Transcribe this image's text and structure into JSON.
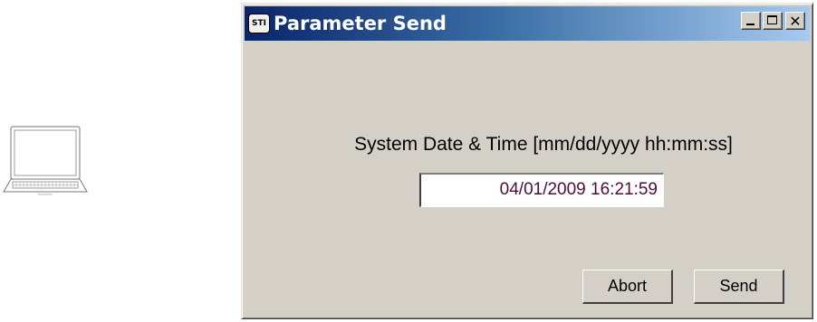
{
  "window": {
    "title": "Parameter Send",
    "app_icon_text": "STI",
    "controls": {
      "minimize": "_",
      "maximize": "□",
      "close": "✕"
    }
  },
  "form": {
    "date_label": "System Date & Time [mm/dd/yyyy hh:mm:ss]",
    "date_value": "04/01/2009 16:21:59"
  },
  "buttons": {
    "abort": "Abort",
    "send": "Send"
  },
  "icons": {
    "laptop": "laptop-icon"
  }
}
